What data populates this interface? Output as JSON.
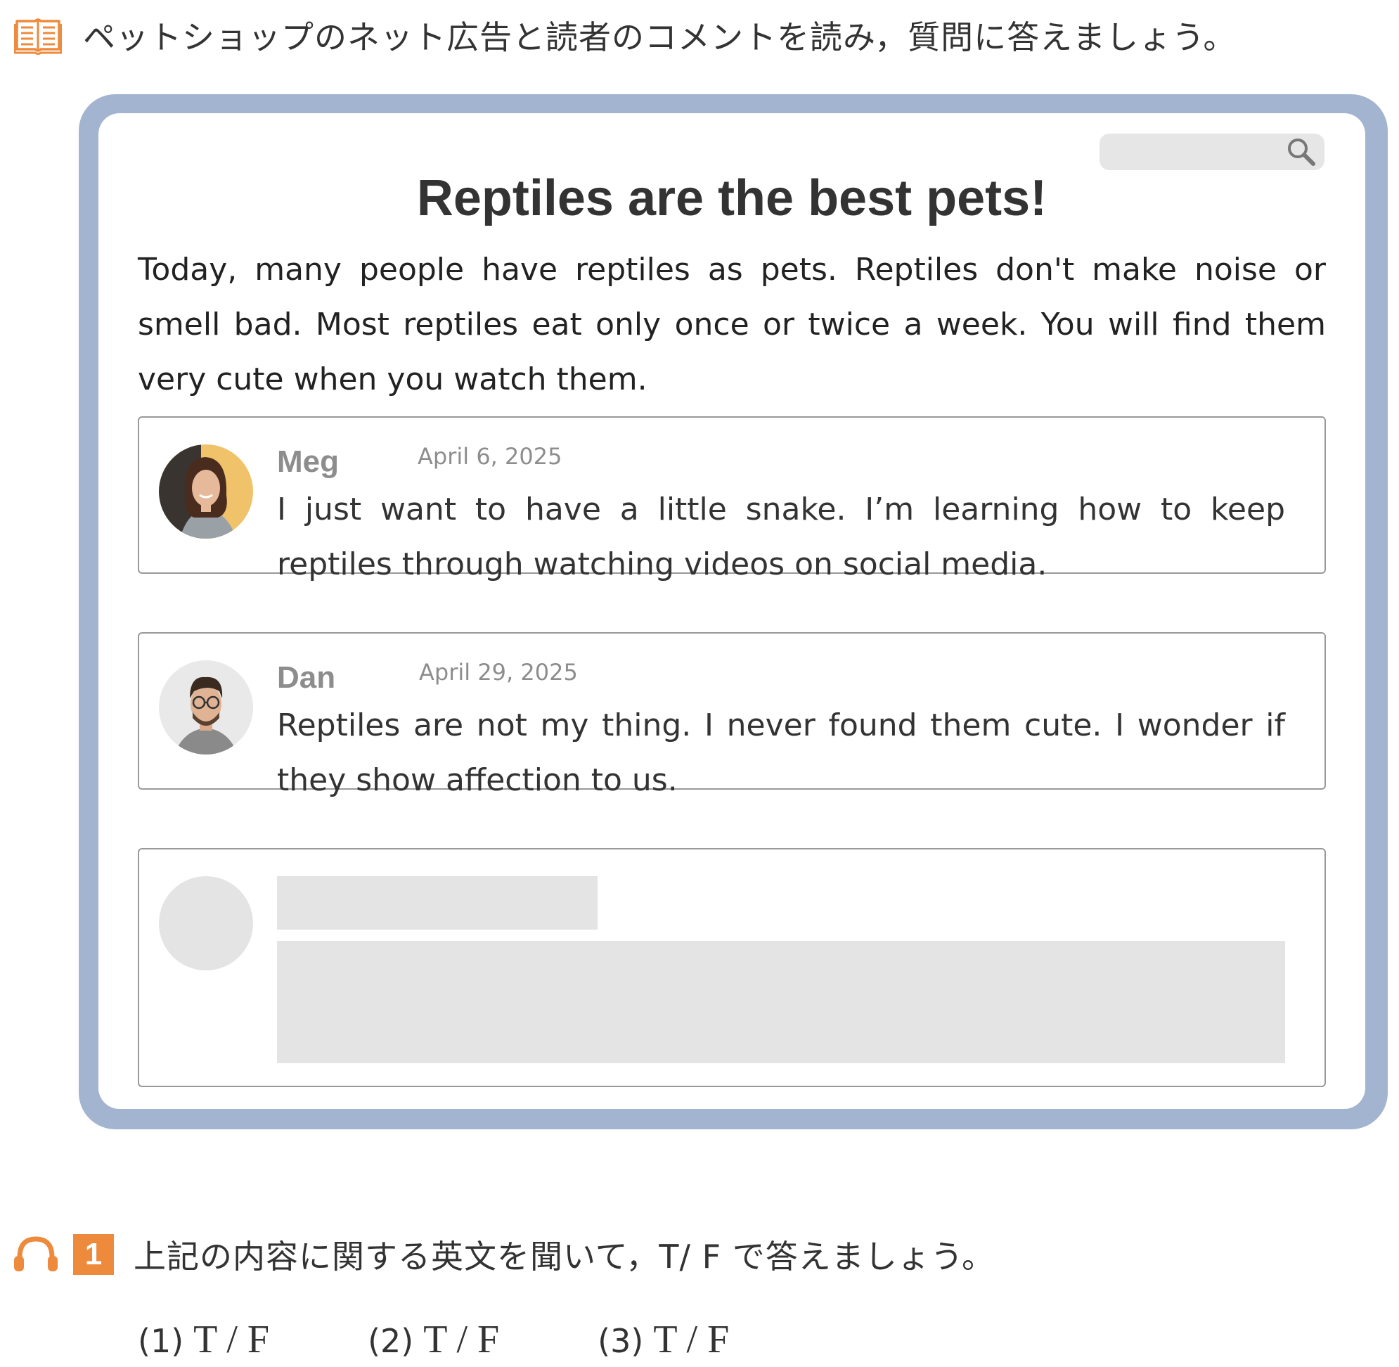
{
  "instruction": {
    "icon": "open-book-icon",
    "text": "ペットショップのネット広告と読者のコメントを読み，質問に答えましょう。"
  },
  "ad": {
    "search": {
      "icon": "search-icon",
      "placeholder": ""
    },
    "title": "Reptiles are the best pets!",
    "body": "Today, many people have reptiles as pets.  Reptiles don't make noise or smell bad.  Most reptiles eat only once or twice a week.  You will find them very cute when you watch them."
  },
  "comments": [
    {
      "name": "Meg",
      "date": "April 6, 2025",
      "text": "I just want to have a little snake.  I’m learning how to keep reptiles through watching videos on social media."
    },
    {
      "name": "Dan",
      "date": "April 29, 2025",
      "text": "Reptiles are not my thing.  I never found them cute.  I wonder if they show affection to us."
    }
  ],
  "question": {
    "icon": "headphone-icon",
    "number": "1",
    "text": "上記の内容に関する英文を聞いて，T/ F で答えましょう。"
  },
  "answers": [
    {
      "num": "(1)",
      "choices": "T / F"
    },
    {
      "num": "(2)",
      "choices": "T / F"
    },
    {
      "num": "(3)",
      "choices": "T / F"
    }
  ],
  "colors": {
    "frame": "#a3b4d1",
    "accent_orange": "#ee8a3c",
    "placeholder_gray": "#e4e4e4"
  }
}
